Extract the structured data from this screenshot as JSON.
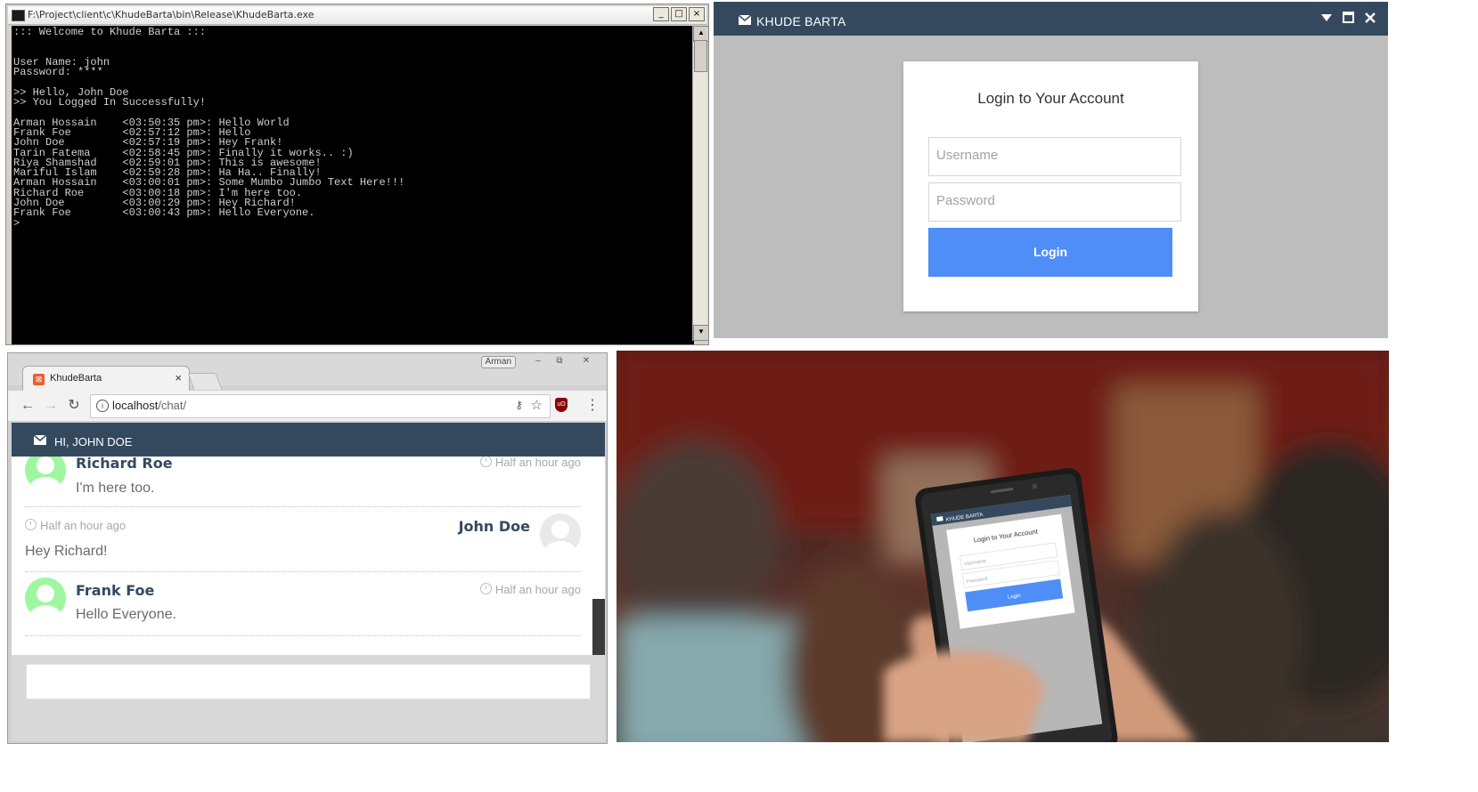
{
  "console": {
    "title": "F:\\Project\\client\\c\\KhudeBarta\\bin\\Release\\KhudeBarta.exe",
    "window_buttons": [
      "_",
      "□",
      "×"
    ],
    "lines": [
      "::: Welcome to Khude Barta :::",
      "",
      "",
      "User Name: john",
      "Password: ****",
      "",
      ">> Hello, John Doe",
      ">> You Logged In Successfully!",
      "",
      "Arman Hossain    <03:50:35 pm>: Hello World",
      "Frank Foe        <02:57:12 pm>: Hello",
      "John Doe         <02:57:19 pm>: Hey Frank!",
      "Tarin Fatema     <02:58:45 pm>: Finally it works.. :)",
      "Riya Shamshad    <02:59:01 pm>: This is awesome!",
      "Mariful Islam    <02:59:28 pm>: Ha Ha.. Finally!",
      "Arman Hossain    <03:00:01 pm>: Some Mumbo Jumbo Text Here!!!",
      "Richard Roe      <03:00:18 pm>: I'm here too.",
      "John Doe         <03:00:29 pm>: Hey Richard!",
      "Frank Foe        <03:00:43 pm>: Hello Everyone.",
      ">"
    ]
  },
  "desktop": {
    "title": "KHUDE BARTA",
    "icons": [
      "mail-icon",
      "minimize-icon",
      "maximize-icon",
      "close-icon"
    ],
    "heading": "Login to Your Account",
    "username_placeholder": "Username",
    "password_placeholder": "Password",
    "login_label": "Login",
    "colors": {
      "bar": "#34495e",
      "button": "#4f8ef6",
      "backdrop": "#bdbdbd"
    }
  },
  "browser": {
    "profile": "Arman",
    "tab_title": "KhudeBarta",
    "url_host": "localhost",
    "url_path": "/chat/",
    "app_title": "HI, JOHN DOE",
    "messages": [
      {
        "author": "Richard Roe",
        "time": "Half an hour ago",
        "text": "I'm here too.",
        "side": "left"
      },
      {
        "author": "John Doe",
        "time": "Half an hour ago",
        "text": "Hey Richard!",
        "side": "right"
      },
      {
        "author": "Frank Foe",
        "time": "Half an hour ago",
        "text": "Hello Everyone.",
        "side": "left"
      }
    ]
  },
  "phone": {
    "app_title": "KHUDE BARTA",
    "heading": "Login to Your Account",
    "username_placeholder": "Username",
    "password_placeholder": "Password",
    "login_label": "Login"
  }
}
